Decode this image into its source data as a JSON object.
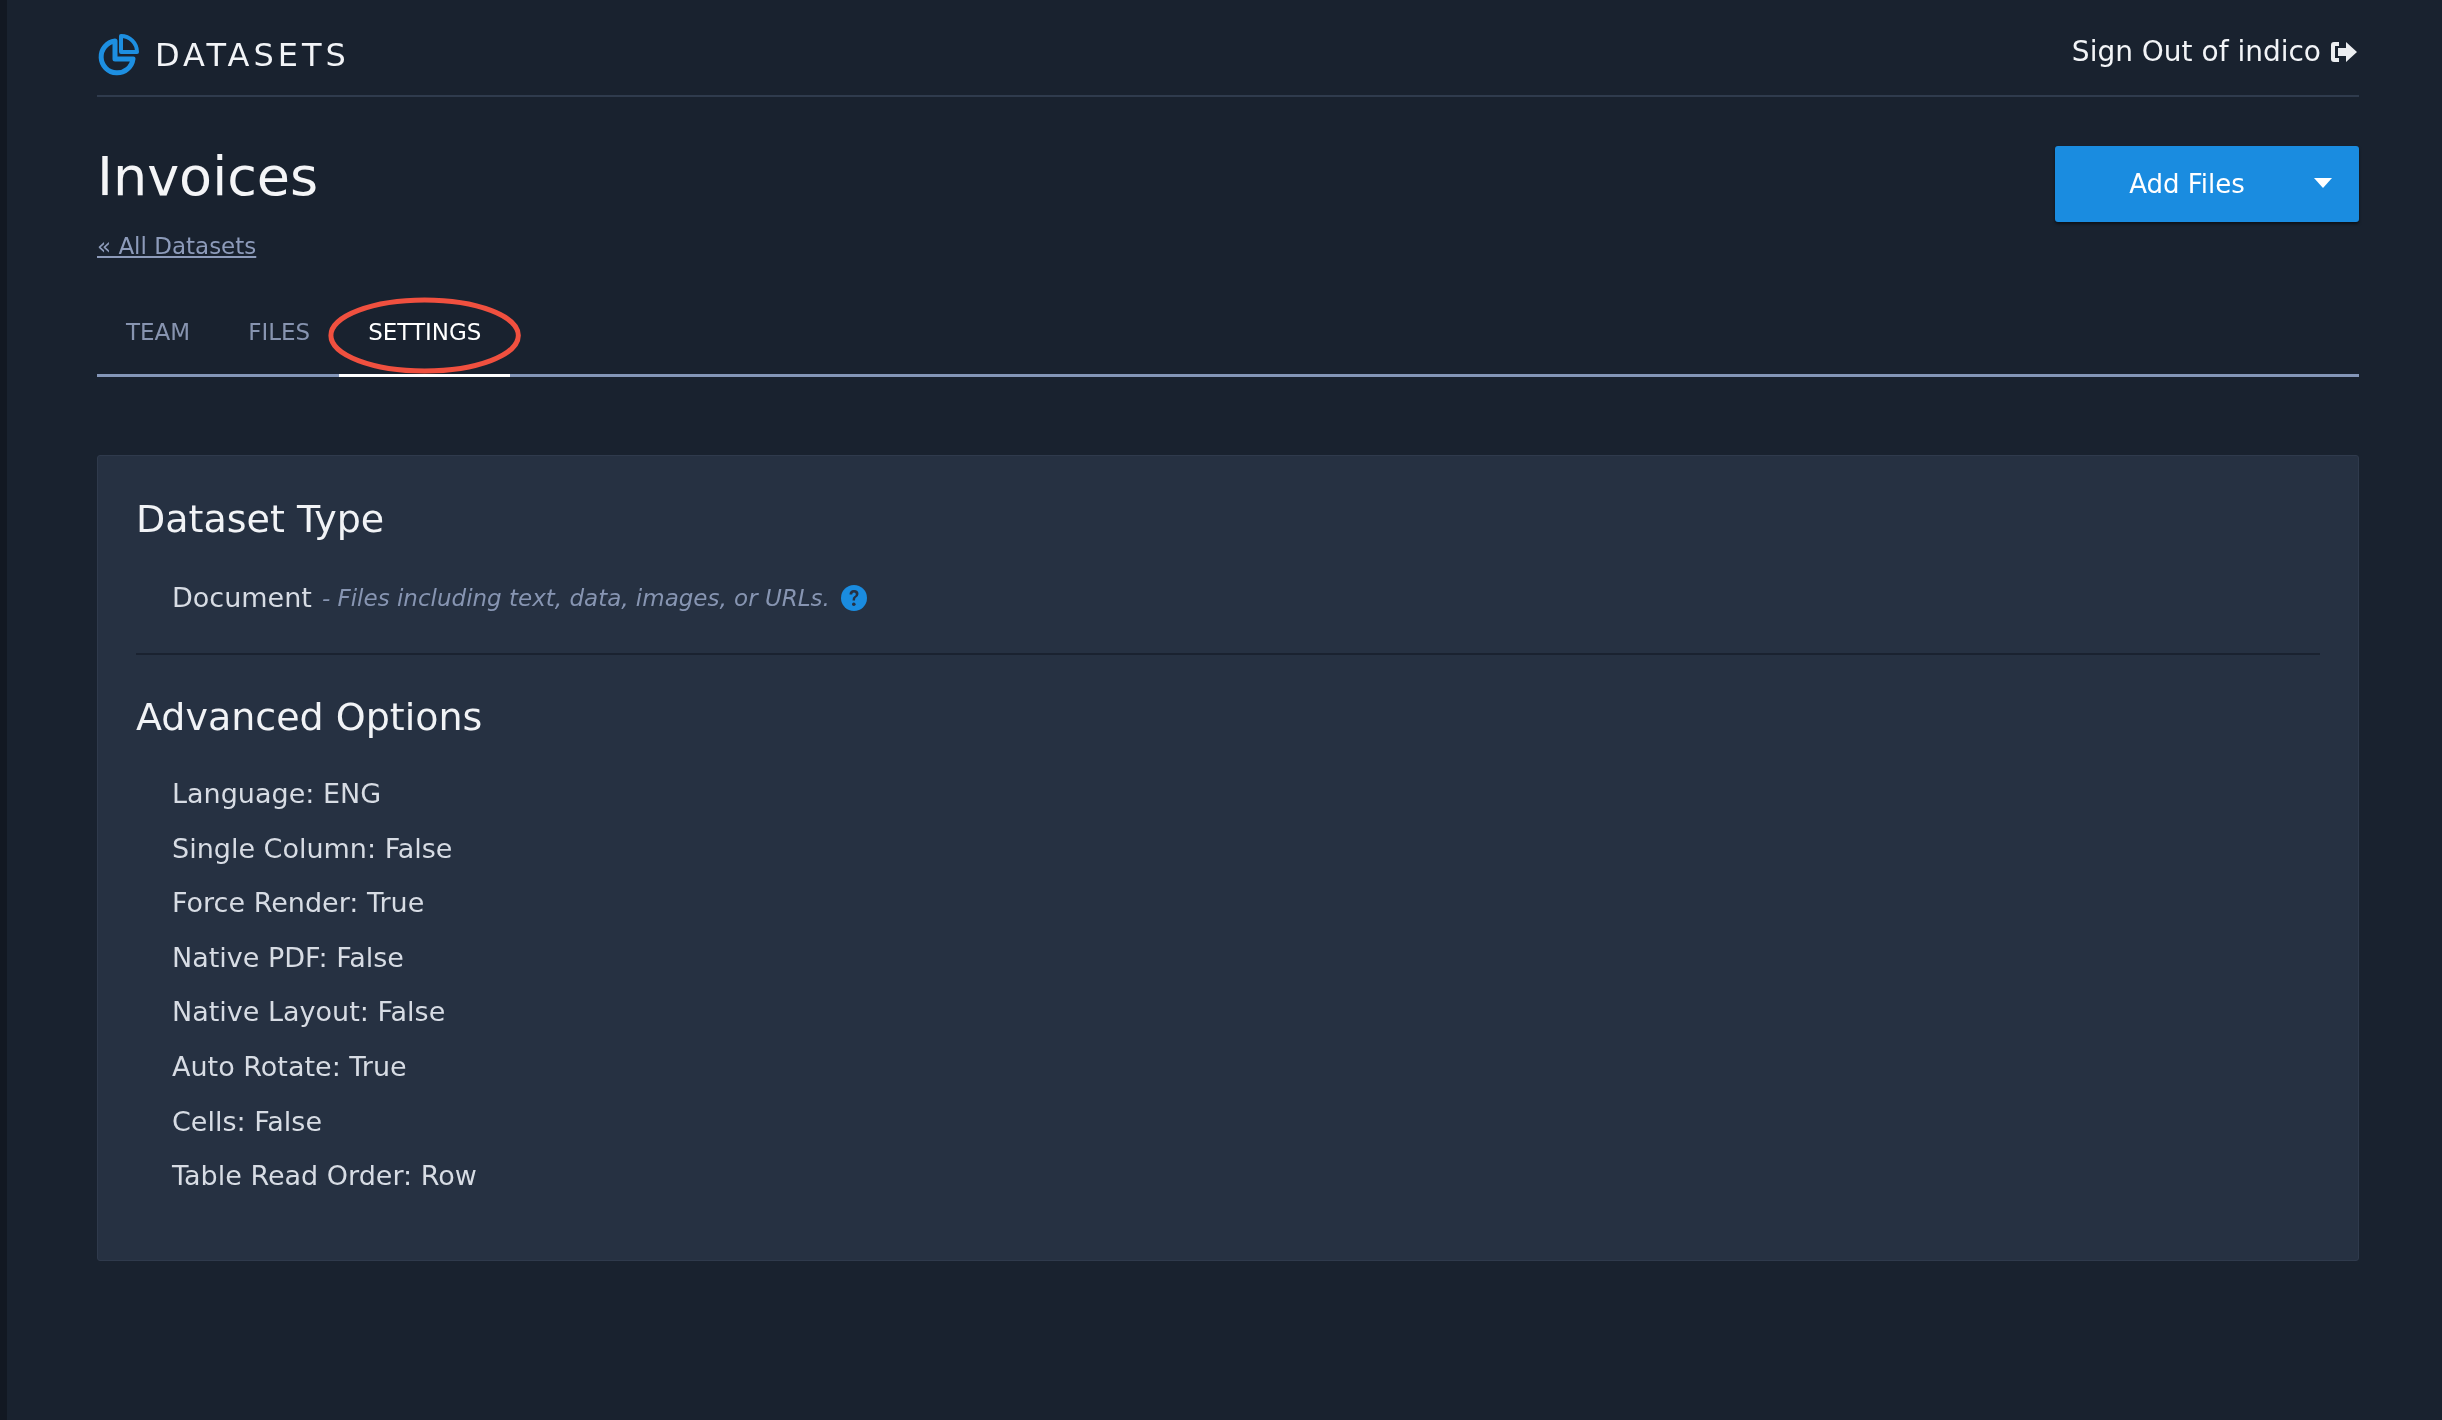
{
  "header": {
    "brand": "DATASETS",
    "sign_out": "Sign Out of indico"
  },
  "page": {
    "title": "Invoices",
    "back_link": "« All Datasets",
    "primary_button": "Add Files"
  },
  "tabs": [
    {
      "label": "TEAM",
      "selected": false,
      "highlighted": false
    },
    {
      "label": "FILES",
      "selected": false,
      "highlighted": false
    },
    {
      "label": "SETTINGS",
      "selected": true,
      "highlighted": true
    }
  ],
  "dataset_type": {
    "heading": "Dataset Type",
    "value": "Document",
    "description": "- Files including text, data, images, or URLs."
  },
  "advanced_options": {
    "heading": "Advanced Options",
    "items": [
      "Language: ENG",
      "Single Column: False",
      "Force Render: True",
      "Native PDF: False",
      "Native Layout: False",
      "Auto Rotate: True",
      "Cells: False",
      "Table Read Order: Row"
    ]
  }
}
